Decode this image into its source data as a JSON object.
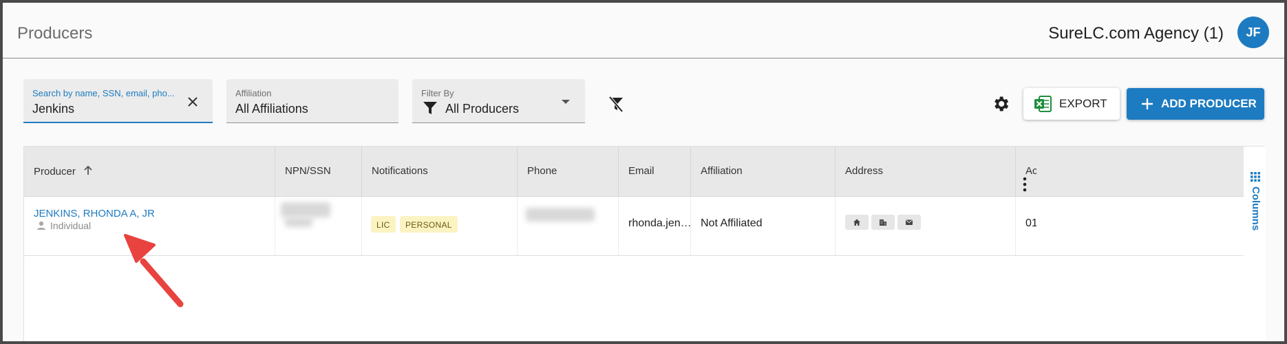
{
  "header": {
    "title": "Producers",
    "agency": "SureLC.com Agency (1)",
    "avatar_initials": "JF"
  },
  "filters": {
    "search": {
      "label": "Search by name, SSN, email, pho...",
      "value": "Jenkins"
    },
    "affiliation": {
      "label": "Affiliation",
      "value": "All Affiliations"
    },
    "filter_by": {
      "label": "Filter By",
      "value": "All Producers"
    }
  },
  "toolbar": {
    "export_label": "EXPORT",
    "add_label": "ADD PRODUCER"
  },
  "table": {
    "columns": [
      "Producer",
      "NPN/SSN",
      "Notifications",
      "Phone",
      "Email",
      "Affiliation",
      "Address",
      "Ac"
    ],
    "rows": [
      {
        "producer": "JENKINS, RHONDA A, JR",
        "type": "Individual",
        "notifications": [
          "LIC",
          "PERSONAL"
        ],
        "email": "rhonda.jen…",
        "affiliation": "Not Affiliated",
        "trailing": "01"
      }
    ],
    "columns_rail_label": "Columns"
  },
  "colors": {
    "accent": "#1d7bc1",
    "badge_bg": "#fbf3c2",
    "arrow": "#e8433f",
    "excel_green": "#1e8e3e"
  },
  "icons": [
    "clear-icon",
    "filter-funnel-icon",
    "clear-filter-icon",
    "settings-gear-icon",
    "excel-icon",
    "plus-icon",
    "sort-up-icon",
    "person-icon",
    "home-icon",
    "building-icon",
    "mail-icon",
    "more-vert-icon",
    "columns-grid-icon",
    "red-arrow-icon"
  ]
}
